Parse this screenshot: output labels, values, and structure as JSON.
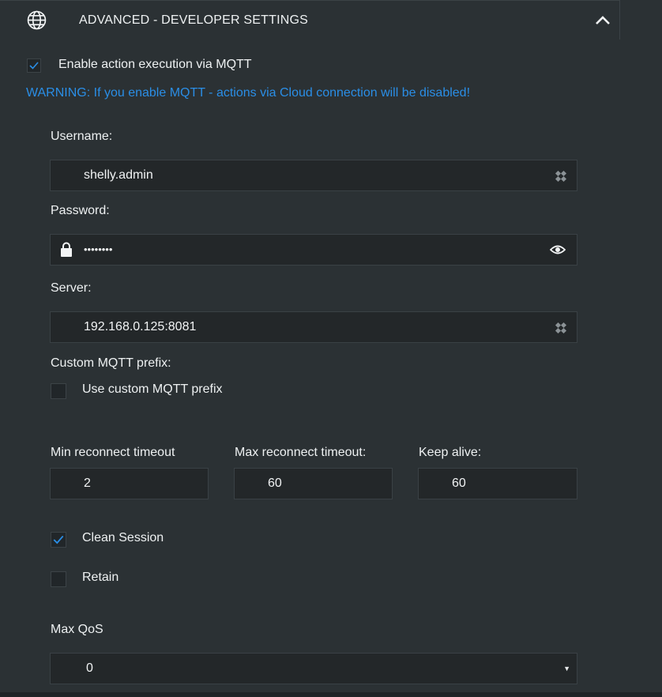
{
  "header": {
    "title": "ADVANCED - DEVELOPER SETTINGS",
    "icon": "globe-icon",
    "collapse_icon": "chevron-up-icon"
  },
  "mqtt_enable": {
    "label": "Enable action execution via MQTT",
    "checked": true
  },
  "warning": "WARNING: If you enable MQTT - actions via Cloud connection will be disabled!",
  "username": {
    "label": "Username:",
    "value": "shelly.admin"
  },
  "password": {
    "label": "Password:",
    "value": "••••••••"
  },
  "server": {
    "label": "Server:",
    "value": "192.168.0.125:8081"
  },
  "custom_prefix": {
    "label": "Custom MQTT prefix:",
    "checkbox_label": "Use custom MQTT prefix",
    "checked": false
  },
  "timeouts": {
    "min_label": "Min reconnect timeout",
    "min_value": "2",
    "max_label": "Max reconnect timeout:",
    "max_value": "60",
    "keepalive_label": "Keep alive:",
    "keepalive_value": "60"
  },
  "clean_session": {
    "label": "Clean Session",
    "checked": true
  },
  "retain": {
    "label": "Retain",
    "checked": false
  },
  "qos": {
    "label": "Max QoS",
    "value": "0"
  },
  "colors": {
    "background": "#2b3134",
    "input_bg": "#232729",
    "accent": "#2a8ee6"
  }
}
